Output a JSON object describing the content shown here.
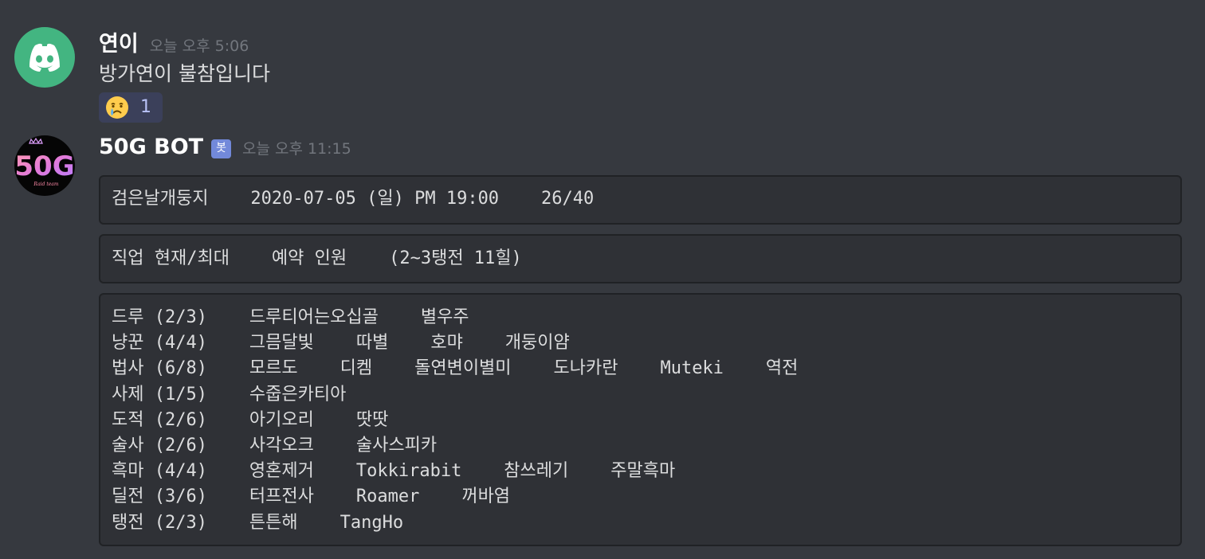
{
  "messages": [
    {
      "author": "연이",
      "timestamp": "오늘 오후 5:06",
      "avatar_icon": "discord-logo-icon",
      "content": "방가연이 불참입니다",
      "reaction": {
        "emoji": "crying-face-icon",
        "count": "1"
      }
    },
    {
      "author": "50G BOT",
      "bot_tag": "봇",
      "timestamp": "오늘 오후 11:15",
      "avatar_icon": "50g-logo-icon",
      "avatar_text": "50G",
      "avatar_subtext": "Raid team",
      "blocks": [
        {
          "lines": [
            "검은날개둥지    2020-07-05 (일) PM 19:00    26/40"
          ]
        },
        {
          "lines": [
            "직업 현재/최대    예약 인원    (2~3탱전 11힐)"
          ]
        },
        {
          "lines": [
            "드루 (2/3)    드루티어는오십골    별우주",
            "냥꾼 (4/4)    그믐달빛    따별    호먀    개둥이얌",
            "법사 (6/8)    모르도    디켐    돌연변이별미    도나카란    Muteki    역전",
            "사제 (1/5)    수줍은카티아",
            "도적 (2/6)    아기오리    땃땃",
            "술사 (2/6)    사각오크    술사스피카",
            "흑마 (4/4)    영혼제거    Tokkirabit    참쓰레기    주말흑마",
            "딜전 (3/6)    터프전사    Roamer    꺼바염",
            "탱전 (2/3)    튼튼해    TangHo"
          ]
        }
      ]
    }
  ],
  "colors": {
    "background": "#36393f",
    "codeblock_bg": "#2f3136",
    "discord_avatar_green": "#43b581",
    "bot_tag": "#7289da",
    "reaction_bg": "#3b405a"
  }
}
